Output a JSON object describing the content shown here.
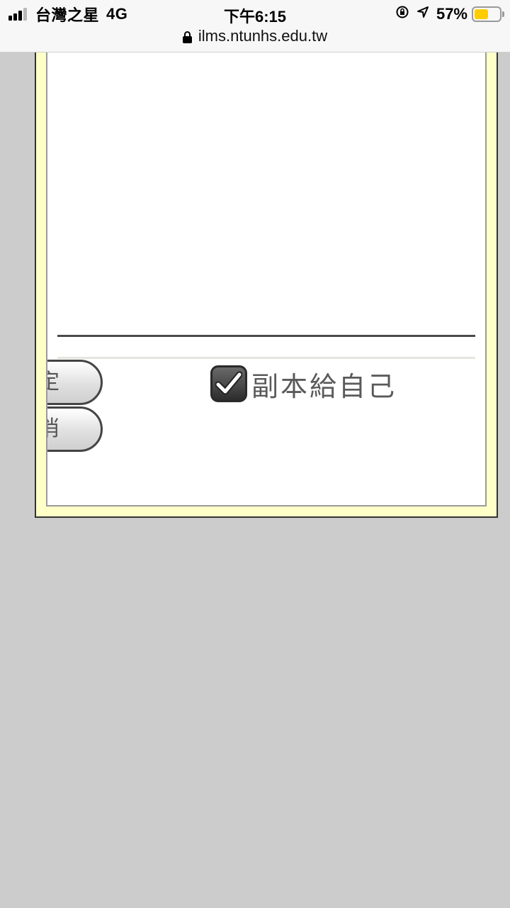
{
  "status_bar": {
    "carrier": "台灣之星",
    "network": "4G",
    "time": "下午6:15",
    "battery_percent": "57%",
    "battery_level": 0.57,
    "battery_color": "#ffcc00",
    "icons": [
      "signal-icon",
      "orientation-lock-icon",
      "location-arrow-icon",
      "battery-icon"
    ]
  },
  "browser": {
    "url": "ilms.ntunhs.edu.tw",
    "secure_icon": "lock-icon"
  },
  "dialog": {
    "frame_color": "#ffffc8",
    "buttons": {
      "ok_label": "定",
      "cancel_label": "消"
    },
    "copy_to_self": {
      "label": "副本給自己",
      "checked": true
    }
  },
  "page_background": "#cccccc"
}
